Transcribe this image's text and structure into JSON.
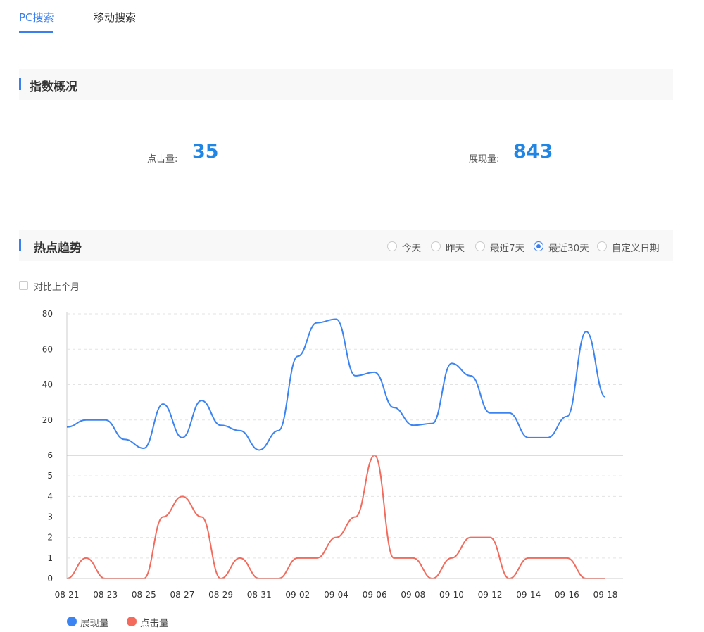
{
  "tabs": [
    {
      "label": "PC搜索",
      "active": true
    },
    {
      "label": "移动搜索",
      "active": false
    }
  ],
  "overview": {
    "title": "指数概况",
    "clicks_label": "点击量:",
    "clicks_value": "35",
    "impressions_label": "展现量:",
    "impressions_value": "843"
  },
  "trend": {
    "title": "热点趋势",
    "ranges": [
      {
        "label": "今天",
        "selected": false
      },
      {
        "label": "昨天",
        "selected": false
      },
      {
        "label": "最近7天",
        "selected": false
      },
      {
        "label": "最近30天",
        "selected": true
      },
      {
        "label": "自定义日期",
        "selected": false
      }
    ],
    "compare_label": "对比上个月",
    "compare_checked": false
  },
  "colors": {
    "accent": "#3b7fef",
    "impressions": "#3d84f3",
    "clicks": "#f26b5c"
  },
  "chart_data": {
    "type": "line",
    "x": [
      "08-21",
      "08-22",
      "08-23",
      "08-24",
      "08-25",
      "08-26",
      "08-27",
      "08-28",
      "08-29",
      "08-30",
      "08-31",
      "09-01",
      "09-02",
      "09-03",
      "09-04",
      "09-05",
      "09-06",
      "09-07",
      "09-08",
      "09-09",
      "09-10",
      "09-11",
      "09-12",
      "09-13",
      "09-14",
      "09-15",
      "09-16",
      "09-17",
      "09-18"
    ],
    "x_tick_labels": [
      "08-21",
      "08-23",
      "08-25",
      "08-27",
      "08-29",
      "08-31",
      "09-02",
      "09-04",
      "09-06",
      "09-08",
      "09-10",
      "09-12",
      "09-14",
      "09-16",
      "09-18"
    ],
    "series": [
      {
        "name": "展现量",
        "color": "#3d84f3",
        "values": [
          16,
          20,
          20,
          9,
          4,
          29,
          10,
          31,
          17,
          14,
          3,
          14,
          56,
          75,
          77,
          45,
          47,
          27,
          17,
          18,
          52,
          45,
          24,
          24,
          10,
          10,
          22,
          70,
          33
        ]
      },
      {
        "name": "点击量",
        "color": "#f26b5c",
        "values": [
          0,
          1,
          0,
          0,
          0,
          3,
          4,
          3,
          0,
          1,
          0,
          0,
          1,
          1,
          2,
          3,
          6,
          1,
          1,
          0,
          1,
          2,
          2,
          0,
          1,
          1,
          1,
          0,
          0
        ]
      }
    ],
    "panels": [
      {
        "series": "展现量",
        "ylim": [
          0,
          80
        ],
        "yticks": [
          20,
          40,
          60,
          80
        ]
      },
      {
        "series": "点击量",
        "ylim": [
          0,
          6
        ],
        "yticks": [
          0,
          1,
          2,
          3,
          4,
          5,
          6
        ]
      }
    ],
    "legend": "bottom-left",
    "grid": true
  }
}
